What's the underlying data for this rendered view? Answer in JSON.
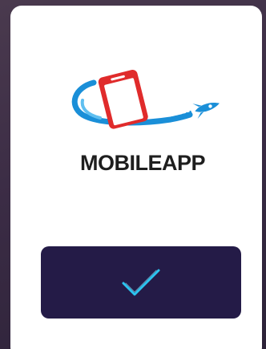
{
  "app": {
    "brand_name": "MOBILEAPP"
  },
  "confirm_button": {
    "icon": "checkmark-icon",
    "icon_color": "#2bc4f0"
  },
  "colors": {
    "card": "#ffffff",
    "button_bg": "#241b47",
    "logo_red": "#e02b2b",
    "logo_blue": "#1a8fd8"
  }
}
